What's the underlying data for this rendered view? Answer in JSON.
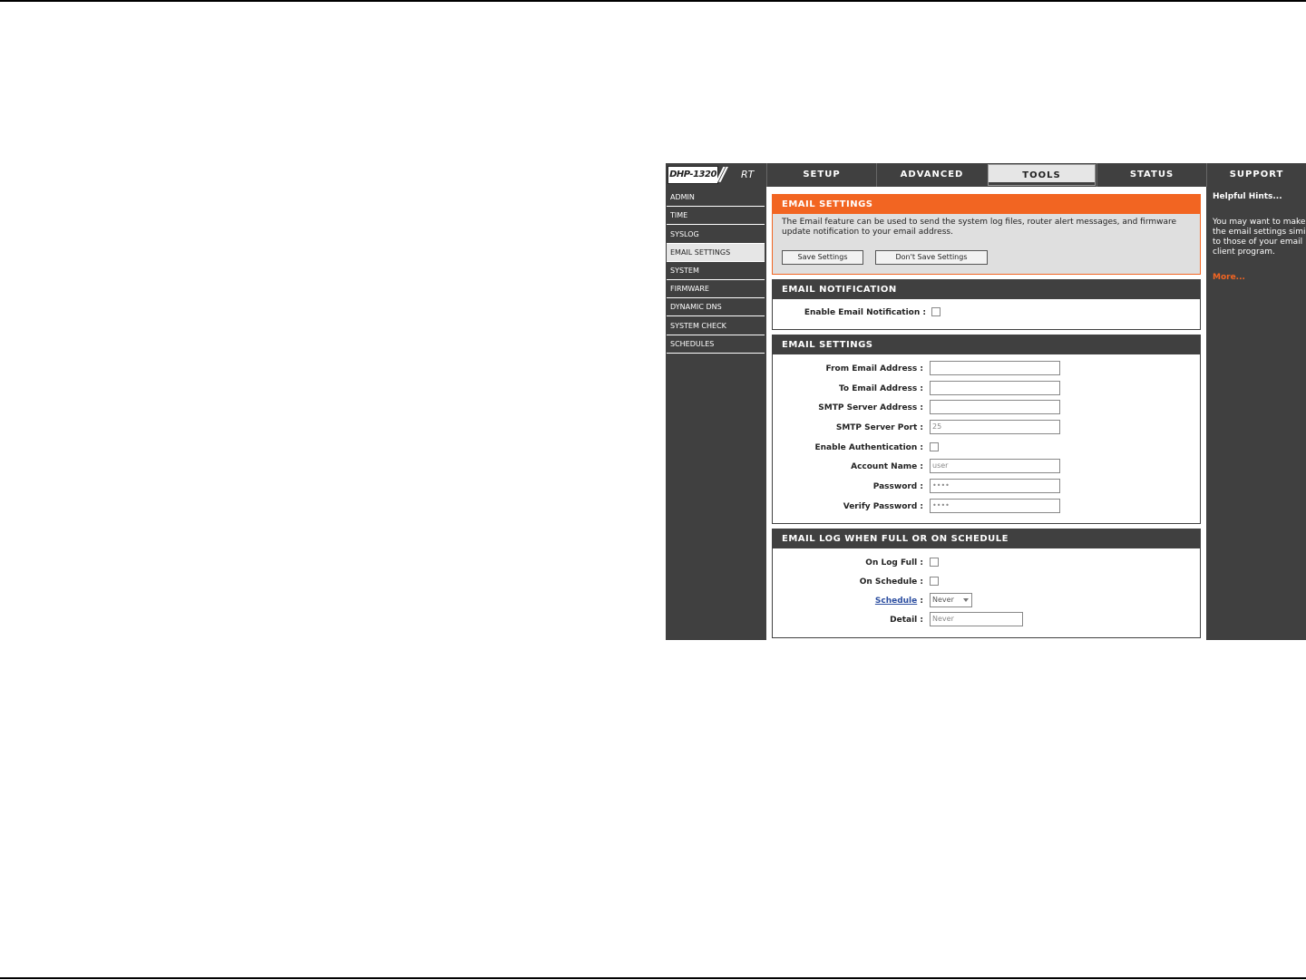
{
  "logo": {
    "model": "DHP-1320",
    "slashes": "//",
    "suffix": "RT"
  },
  "tabs": [
    {
      "label": "SETUP"
    },
    {
      "label": "ADVANCED"
    },
    {
      "label": "TOOLS"
    },
    {
      "label": "STATUS"
    },
    {
      "label": "SUPPORT"
    }
  ],
  "active_tab": "TOOLS",
  "sidebar": {
    "items": [
      {
        "label": "ADMIN"
      },
      {
        "label": "TIME"
      },
      {
        "label": "SYSLOG"
      },
      {
        "label": "EMAIL SETTINGS"
      },
      {
        "label": "SYSTEM"
      },
      {
        "label": "FIRMWARE"
      },
      {
        "label": "DYNAMIC DNS"
      },
      {
        "label": "SYSTEM CHECK"
      },
      {
        "label": "SCHEDULES"
      }
    ],
    "active": "EMAIL SETTINGS"
  },
  "intro": {
    "title": "EMAIL SETTINGS",
    "text": "The Email feature can be used to send the system log files, router alert messages, and firmware update notification to your email address.",
    "save_label": "Save Settings",
    "dont_save_label": "Don't Save Settings"
  },
  "notification": {
    "title": "EMAIL NOTIFICATION",
    "enable_label": "Enable Email Notification :",
    "enable_checked": false
  },
  "email_settings": {
    "title": "EMAIL SETTINGS",
    "from_label": "From Email Address :",
    "from_value": "",
    "to_label": "To Email Address :",
    "to_value": "",
    "smtp_address_label": "SMTP Server Address :",
    "smtp_address_value": "",
    "smtp_port_label": "SMTP Server Port :",
    "smtp_port_value": "25",
    "auth_label": "Enable Authentication :",
    "auth_checked": false,
    "account_label": "Account Name :",
    "account_value": "user",
    "password_label": "Password :",
    "password_value": "••••",
    "verify_label": "Verify Password :",
    "verify_value": "••••"
  },
  "email_log": {
    "title": "EMAIL LOG WHEN FULL OR ON SCHEDULE",
    "log_full_label": "On Log Full :",
    "on_schedule_label": "On Schedule :",
    "schedule_link": "Schedule",
    "schedule_colon": ":",
    "schedule_value": "Never",
    "detail_label": "Detail :",
    "detail_value": "Never"
  },
  "hints": {
    "title": "Helpful Hints...",
    "text": "You may want to make\nthe email settings similar\nto those of your email\nclient program.",
    "more": "More..."
  },
  "colors": {
    "accent": "#f26522",
    "dark": "#404040",
    "link": "#2c4ea0"
  }
}
